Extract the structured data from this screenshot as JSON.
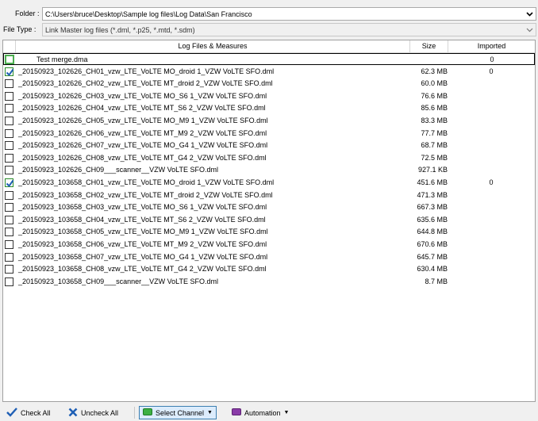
{
  "folder": {
    "label": "Folder :",
    "value": "C:\\Users\\bruce\\Desktop\\Sample log files\\Log Data\\San Francisco"
  },
  "file_type": {
    "label": "File Type :",
    "value": "Link Master log files (*.dml, *.p25, *.mtd, *.sdm)"
  },
  "grid": {
    "headers": {
      "name": "Log Files & Measures",
      "size": "Size",
      "imported": "Imported"
    },
    "rows": [
      {
        "name": "Test merge.dma",
        "size": "",
        "imported": "0",
        "checked": false,
        "selected": true
      },
      {
        "name": "_20150923_102626_CH01_vzw_LTE_VoLTE MO_droid 1_VZW VoLTE SFO.dml",
        "size": "62.3 MB",
        "imported": "0",
        "checked": true
      },
      {
        "name": "_20150923_102626_CH02_vzw_LTE_VoLTE MT_droid 2_VZW VoLTE SFO.dml",
        "size": "60.0 MB",
        "imported": "",
        "checked": false
      },
      {
        "name": "_20150923_102626_CH03_vzw_LTE_VoLTE MO_S6 1_VZW VoLTE SFO.dml",
        "size": "76.6 MB",
        "imported": "",
        "checked": false
      },
      {
        "name": "_20150923_102626_CH04_vzw_LTE_VoLTE MT_S6 2_VZW VoLTE SFO.dml",
        "size": "85.6 MB",
        "imported": "",
        "checked": false
      },
      {
        "name": "_20150923_102626_CH05_vzw_LTE_VoLTE MO_M9 1_VZW VoLTE SFO.dml",
        "size": "83.3 MB",
        "imported": "",
        "checked": false
      },
      {
        "name": "_20150923_102626_CH06_vzw_LTE_VoLTE MT_M9 2_VZW VoLTE SFO.dml",
        "size": "77.7 MB",
        "imported": "",
        "checked": false
      },
      {
        "name": "_20150923_102626_CH07_vzw_LTE_VoLTE MO_G4 1_VZW VoLTE SFO.dml",
        "size": "68.7 MB",
        "imported": "",
        "checked": false
      },
      {
        "name": "_20150923_102626_CH08_vzw_LTE_VoLTE MT_G4 2_VZW VoLTE SFO.dml",
        "size": "72.5 MB",
        "imported": "",
        "checked": false
      },
      {
        "name": "_20150923_102626_CH09___scanner__VZW VoLTE SFO.dml",
        "size": "927.1 KB",
        "imported": "",
        "checked": false
      },
      {
        "name": "_20150923_103658_CH01_vzw_LTE_VoLTE MO_droid 1_VZW VoLTE SFO.dml",
        "size": "451.6 MB",
        "imported": "0",
        "checked": true
      },
      {
        "name": "_20150923_103658_CH02_vzw_LTE_VoLTE MT_droid 2_VZW VoLTE SFO.dml",
        "size": "471.3 MB",
        "imported": "",
        "checked": false
      },
      {
        "name": "_20150923_103658_CH03_vzw_LTE_VoLTE MO_S6 1_VZW VoLTE SFO.dml",
        "size": "667.3 MB",
        "imported": "",
        "checked": false
      },
      {
        "name": "_20150923_103658_CH04_vzw_LTE_VoLTE MT_S6 2_VZW VoLTE SFO.dml",
        "size": "635.6 MB",
        "imported": "",
        "checked": false
      },
      {
        "name": "_20150923_103658_CH05_vzw_LTE_VoLTE MO_M9 1_VZW VoLTE SFO.dml",
        "size": "644.8 MB",
        "imported": "",
        "checked": false
      },
      {
        "name": "_20150923_103658_CH06_vzw_LTE_VoLTE MT_M9 2_VZW VoLTE SFO.dml",
        "size": "670.6 MB",
        "imported": "",
        "checked": false
      },
      {
        "name": "_20150923_103658_CH07_vzw_LTE_VoLTE MO_G4 1_VZW VoLTE SFO.dml",
        "size": "645.7 MB",
        "imported": "",
        "checked": false
      },
      {
        "name": "_20150923_103658_CH08_vzw_LTE_VoLTE MT_G4 2_VZW VoLTE SFO.dml",
        "size": "630.4 MB",
        "imported": "",
        "checked": false
      },
      {
        "name": "_20150923_103658_CH09___scanner__VZW VoLTE SFO.dml",
        "size": "8.7 MB",
        "imported": "",
        "checked": false
      }
    ]
  },
  "toolbar": {
    "check_all": "Check All",
    "uncheck_all": "Uncheck All",
    "select_channel": "Select Channel",
    "automation": "Automation"
  },
  "colors": {
    "check_green": "#2a8c2a",
    "uncheck_blue": "#1f5fb5",
    "channel_green": "#3cb043",
    "automation_purple": "#8a3ca8"
  }
}
